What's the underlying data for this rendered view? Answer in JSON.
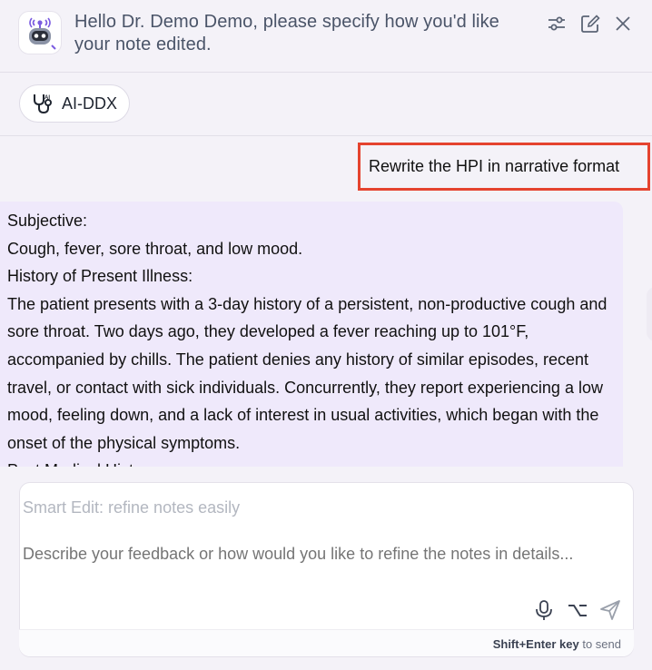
{
  "header": {
    "title": "Hello Dr. Demo Demo, please specify how you'd like your note edited.",
    "icons": [
      "settings-sliders-icon",
      "edit-icon",
      "close-icon"
    ]
  },
  "chips": [
    {
      "label": "AI-DDX",
      "icon": "stethoscope-icon"
    }
  ],
  "chat": {
    "user_message": "Rewrite the HPI in narrative format",
    "ai_message": {
      "lines": [
        "Subjective:",
        "Cough, fever, sore throat, and low mood.",
        "History of Present Illness:",
        "The patient presents with a 3-day history of a persistent, non-productive cough and sore throat. Two days ago, they developed a fever reaching up to 101°F, accompanied by chills. The patient denies any history of similar episodes, recent travel, or contact with sick individuals. Concurrently, they report experiencing a low mood, feeling down, and a lack of interest in usual activities, which began with the onset of the physical symptoms.",
        "Past Medical History:"
      ]
    }
  },
  "input": {
    "title_placeholder": "Smart Edit: refine notes easily",
    "desc_placeholder": "Describe your feedback or how would you like to refine the notes in details...",
    "hint_key": "Shift+Enter key",
    "hint_text": "to send"
  },
  "colors": {
    "accent_purple": "#7b5ce0",
    "highlight_red": "#e5432f",
    "ai_bubble": "#efe9fb"
  }
}
